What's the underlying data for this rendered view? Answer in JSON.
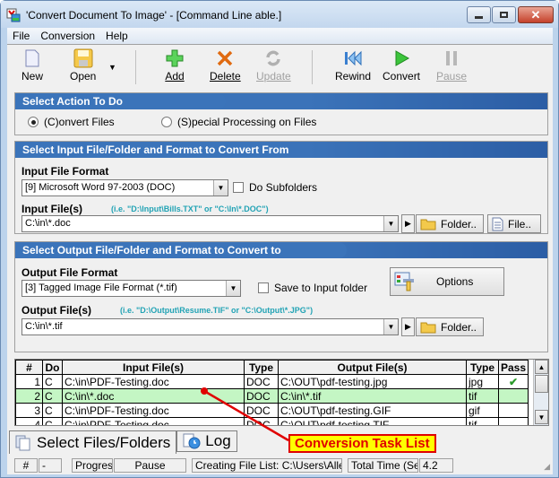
{
  "window": {
    "title": "'Convert Document To Image' - [Command Line able.]",
    "controls": {
      "minimize": "minimize",
      "maximize": "maximize",
      "close": "close"
    }
  },
  "menu": [
    "File",
    "Conversion",
    "Help"
  ],
  "toolbar": {
    "new": "New",
    "open": "Open",
    "add": "Add",
    "delete": "Delete",
    "update": "Update",
    "rewind": "Rewind",
    "convert": "Convert",
    "pause": "Pause"
  },
  "action_panel": {
    "title": "Select Action To Do",
    "options": [
      {
        "label": "(C)onvert Files",
        "selected": true
      },
      {
        "label": "(S)pecial Processing on Files",
        "selected": false
      }
    ]
  },
  "input_panel": {
    "title": "Select Input File/Folder and Format to Convert From",
    "format_label": "Input File Format",
    "format_value": "[9] Microsoft Word 97-2003 (DOC)",
    "subfolders_label": "Do Subfolders",
    "subfolders_checked": false,
    "files_label": "Input File(s)",
    "files_hint": "(i.e. \"D:\\Input\\Bills.TXT\"  or \"C:\\In\\*.DOC\")",
    "files_value": "C:\\in\\*.doc",
    "folder_button": "Folder..",
    "file_button": "File.."
  },
  "output_panel": {
    "title": "Select Output File/Folder and Format to Convert to",
    "format_label": "Output File Format",
    "format_value": "[3] Tagged Image File Format (*.tif)",
    "save_input_label": "Save to Input folder",
    "save_input_checked": false,
    "options_button": "Options",
    "files_label": "Output File(s)",
    "files_hint": "(i.e. \"D:\\Output\\Resume.TIF\" or \"C:\\Output\\*.JPG\")",
    "files_value": "C:\\in\\*.tif",
    "folder_button": "Folder.."
  },
  "task_list": {
    "columns": [
      "#",
      "Do",
      "Input File(s)",
      "Type",
      "Output File(s)",
      "Type",
      "Pass"
    ],
    "rows": [
      {
        "num": "1",
        "do": "C",
        "input": "C:\\in\\PDF-Testing.doc",
        "in_type": "DOC",
        "output": "C:\\OUT\\pdf-testing.jpg",
        "out_type": "jpg",
        "pass": "✔"
      },
      {
        "num": "2",
        "do": "C",
        "input": "C:\\in\\*.doc",
        "in_type": "DOC",
        "output": "C:\\in\\*.tif",
        "out_type": "tif",
        "pass": ""
      },
      {
        "num": "3",
        "do": "C",
        "input": "C:\\in\\PDF-Testing.doc",
        "in_type": "DOC",
        "output": "C:\\OUT\\pdf-testing.GIF",
        "out_type": "gif",
        "pass": ""
      },
      {
        "num": "4",
        "do": "C",
        "input": "C:\\in\\PDF-Testing.doc",
        "in_type": "DOC",
        "output": "C:\\OUT\\pdf-testing.TIF",
        "out_type": "tif",
        "pass": ""
      }
    ]
  },
  "bottom_tabs": [
    "Select Files/Folders",
    "Log"
  ],
  "callout": "Conversion Task List",
  "status": {
    "hash": "#",
    "num": "-",
    "progress_label": "Progress:",
    "progress_value": "Pause",
    "message": "Creating File List: C:\\Users\\Allen\\AppDat",
    "time_label": "Total Time (Sec):",
    "time_value": "4.2"
  }
}
